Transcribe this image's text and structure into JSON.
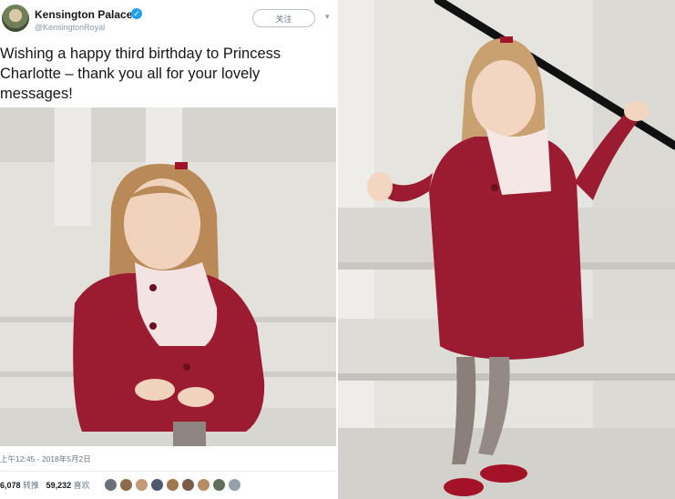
{
  "tweet": {
    "account_name": "Kensington Palace",
    "handle": "@KensingtonRoyal",
    "follow_label": "关注",
    "text": "Wishing a happy third birthday to Princess Charlotte – thank you all for your lovely messages!",
    "timestamp": "上午12:45 - 2018年5月2日",
    "retweets_count": "6,078",
    "retweets_label": "转推",
    "likes_count": "59,232",
    "likes_label": "喜欢",
    "liker_avatar_colors": [
      "#6b6f7a",
      "#8c6a4a",
      "#c49a76",
      "#4d5a6b",
      "#a0784e",
      "#7b5b4b",
      "#b58c63",
      "#5f6f5a",
      "#93a0aa"
    ]
  },
  "icons": {
    "verified": "verified-badge-icon",
    "caret": "chevron-down-icon"
  },
  "colors": {
    "coat": "#9b1b30",
    "accent_blue": "#1da1f2",
    "text_dark": "#14171a",
    "muted": "#657786"
  }
}
